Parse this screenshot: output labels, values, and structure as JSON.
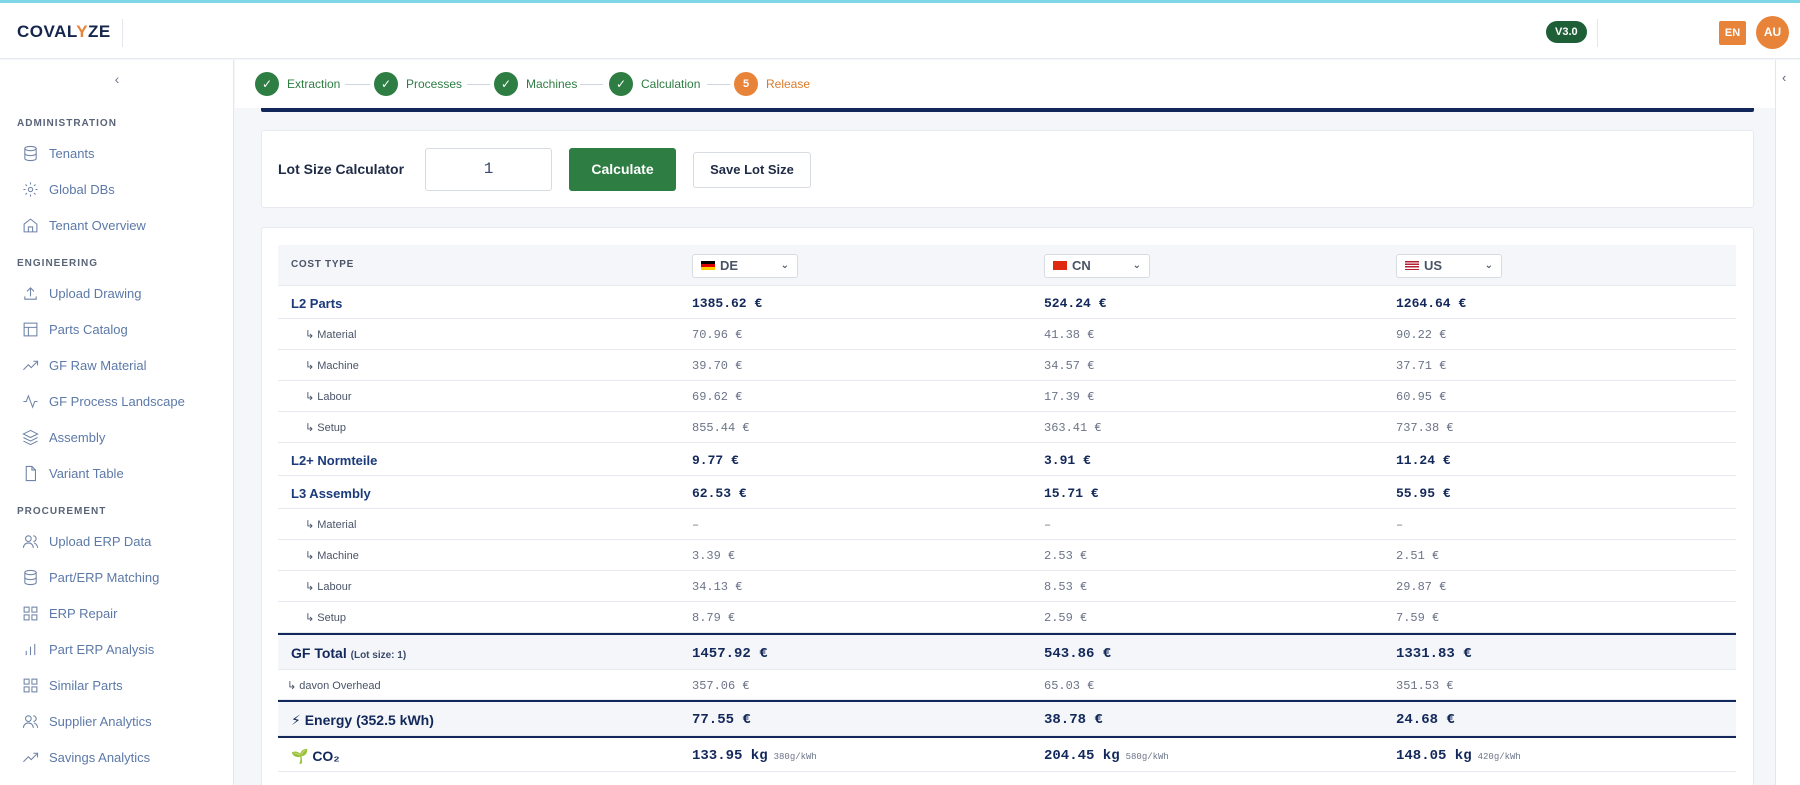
{
  "app": {
    "logo_pre": "COVAL",
    "logo_accent": "Y",
    "logo_post": "ZE",
    "version": "V3.0",
    "language": "EN",
    "user_initials": "AU"
  },
  "colors": {
    "brand_orange": "#e8833a",
    "brand_green": "#2e7d43",
    "navy": "#13285a"
  },
  "sidebar": {
    "sections": [
      {
        "title": "ADMINISTRATION",
        "items": [
          {
            "label": "Tenants",
            "icon": "database-icon"
          },
          {
            "label": "Global DBs",
            "icon": "gear-icon"
          },
          {
            "label": "Tenant Overview",
            "icon": "home-icon"
          }
        ]
      },
      {
        "title": "ENGINEERING",
        "items": [
          {
            "label": "Upload Drawing",
            "icon": "upload-icon"
          },
          {
            "label": "Parts Catalog",
            "icon": "table-icon"
          },
          {
            "label": "GF Raw Material",
            "icon": "trending-icon"
          },
          {
            "label": "GF Process Landscape",
            "icon": "activity-icon"
          },
          {
            "label": "Assembly",
            "icon": "layers-icon"
          },
          {
            "label": "Variant Table",
            "icon": "file-icon"
          }
        ]
      },
      {
        "title": "PROCUREMENT",
        "items": [
          {
            "label": "Upload ERP Data",
            "icon": "users-icon"
          },
          {
            "label": "Part/ERP Matching",
            "icon": "database-icon"
          },
          {
            "label": "ERP Repair",
            "icon": "grid-icon"
          },
          {
            "label": "Part ERP Analysis",
            "icon": "bar-chart-icon"
          },
          {
            "label": "Similar Parts",
            "icon": "grid-icon"
          },
          {
            "label": "Supplier Analytics",
            "icon": "users-icon"
          },
          {
            "label": "Savings Analytics",
            "icon": "trending-icon"
          }
        ]
      }
    ]
  },
  "stepper": {
    "steps": [
      {
        "label": "Extraction",
        "marker": "✓",
        "state": "done"
      },
      {
        "label": "Processes",
        "marker": "✓",
        "state": "done"
      },
      {
        "label": "Machines",
        "marker": "✓",
        "state": "done"
      },
      {
        "label": "Calculation",
        "marker": "✓",
        "state": "done"
      },
      {
        "label": "Release",
        "marker": "5",
        "state": "active"
      }
    ]
  },
  "lot": {
    "label": "Lot Size Calculator",
    "value": "1",
    "calculate_label": "Calculate",
    "save_label": "Save Lot Size"
  },
  "table": {
    "header": "COST TYPE",
    "countries": [
      "DE",
      "CN",
      "US"
    ],
    "l2": {
      "label": "L2 Parts",
      "values": [
        "1385.62 €",
        "524.24 €",
        "1264.64 €"
      ]
    },
    "l2_sub": [
      {
        "label": "↳ Material",
        "values": [
          "70.96 €",
          "41.38 €",
          "90.22 €"
        ]
      },
      {
        "label": "↳ Machine",
        "values": [
          "39.70 €",
          "34.57 €",
          "37.71 €"
        ]
      },
      {
        "label": "↳ Labour",
        "values": [
          "69.62 €",
          "17.39 €",
          "60.95 €"
        ]
      },
      {
        "label": "↳ Setup",
        "values": [
          "855.44 €",
          "363.41 €",
          "737.38 €"
        ]
      }
    ],
    "normteile": {
      "label": "L2+ Normteile",
      "values": [
        "9.77 €",
        "3.91 €",
        "11.24 €"
      ]
    },
    "l3": {
      "label": "L3 Assembly",
      "values": [
        "62.53 €",
        "15.71 €",
        "55.95 €"
      ]
    },
    "l3_sub": [
      {
        "label": "↳ Material",
        "values": [
          "–",
          "–",
          "–"
        ]
      },
      {
        "label": "↳ Machine",
        "values": [
          "3.39 €",
          "2.53 €",
          "2.51 €"
        ]
      },
      {
        "label": "↳ Labour",
        "values": [
          "34.13 €",
          "8.53 €",
          "29.87 €"
        ]
      },
      {
        "label": "↳ Setup",
        "values": [
          "8.79 €",
          "2.59 €",
          "7.59 €"
        ]
      }
    ],
    "total": {
      "label": "GF Total",
      "note": "(Lot size: 1)",
      "values": [
        "1457.92 €",
        "543.86 €",
        "1331.83 €"
      ]
    },
    "overhead": {
      "label": "↳ davon Overhead",
      "values": [
        "357.06 €",
        "65.03 €",
        "351.53 €"
      ]
    },
    "energy": {
      "label": "⚡ Energy (352.5 kWh)",
      "values": [
        "77.55 €",
        "38.78 €",
        "24.68 €"
      ]
    },
    "co2": {
      "label": "🌱 CO₂",
      "values": [
        "133.95 kg",
        "204.45 kg",
        "148.05 kg"
      ],
      "intensity": [
        "380g/kWh",
        "580g/kWh",
        "420g/kWh"
      ]
    }
  }
}
